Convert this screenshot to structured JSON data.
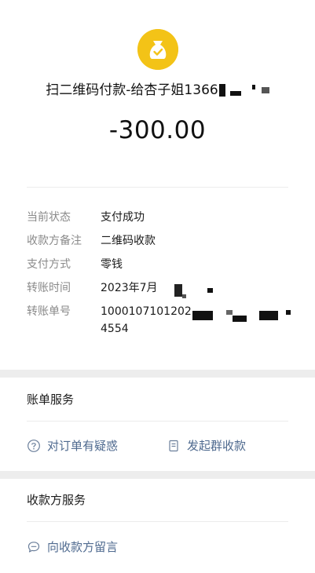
{
  "header": {
    "title_prefix": "扫二维码付款-给杏子姐1366",
    "amount": "-300.00"
  },
  "details": {
    "status_label": "当前状态",
    "status_value": "支付成功",
    "note_label": "收款方备注",
    "note_value": "二维码收款",
    "method_label": "支付方式",
    "method_value": "零钱",
    "time_label": "转账时间",
    "time_value": "2023年7月",
    "txn_label": "转账单号",
    "txn_value_line1": "1000107101202",
    "txn_value_line2": "4554"
  },
  "bill_service": {
    "title": "账单服务",
    "question_label": "对订单有疑惑",
    "group_collect_label": "发起群收款"
  },
  "payee_service": {
    "title": "收款方服务",
    "message_label": "向收款方留言"
  },
  "colors": {
    "logo": "#f3c317",
    "link": "#4f6a8f",
    "label": "#8a8a8a"
  }
}
